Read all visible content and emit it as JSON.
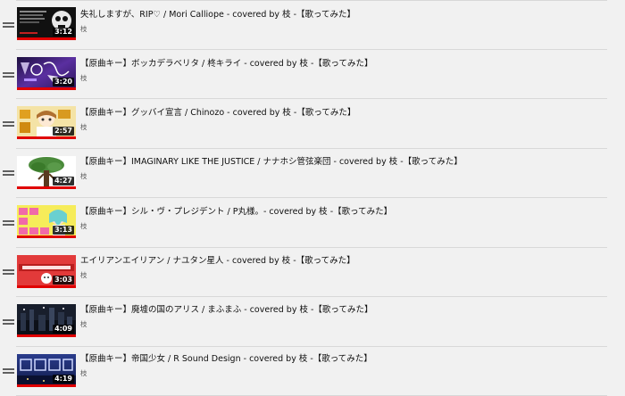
{
  "playlist": {
    "items": [
      {
        "title": "失礼しますが、RIP♡ / Mori Calliope - covered by 枝 -【歌ってみた】",
        "channel": "枝",
        "duration": "3:12",
        "thumb_icon": "thumbnail-dark-skull-image",
        "thumb_color": "#111111"
      },
      {
        "title": "【原曲キー】ボッカデラベリタ / 柊キライ - covered by 枝 -【歌ってみた】",
        "channel": "枝",
        "duration": "3:20",
        "thumb_icon": "thumbnail-purple-text-image",
        "thumb_color": "#3a1a6b"
      },
      {
        "title": "【原曲キー】グッバイ宣言 / Chinozo - covered by 枝 -【歌ってみた】",
        "channel": "枝",
        "duration": "2:57",
        "thumb_icon": "thumbnail-anime-girl-yellow-image",
        "thumb_color": "#f2e2a0"
      },
      {
        "title": "【原曲キー】IMAGINARY LIKE THE JUSTICE / ナナホシ管弦楽団 - covered by 枝 -【歌ってみた】",
        "channel": "枝",
        "duration": "4:27",
        "thumb_icon": "thumbnail-tree-image",
        "thumb_color": "#ffffff"
      },
      {
        "title": "【原曲キー】シル・ヴ・プレジデント / P丸様。- covered by 枝 -【歌ってみた】",
        "channel": "枝",
        "duration": "3:13",
        "thumb_icon": "thumbnail-pink-yellow-image",
        "thumb_color": "#f4e860"
      },
      {
        "title": "エイリアンエイリアン / ナユタン星人 - covered by 枝 -【歌ってみた】",
        "channel": "枝",
        "duration": "3:03",
        "thumb_icon": "thumbnail-red-alien-image",
        "thumb_color": "#e03a3a"
      },
      {
        "title": "【原曲キー】廃墟の国のアリス / まふまふ - covered by 枝 -【歌ってみた】",
        "channel": "枝",
        "duration": "4:09",
        "thumb_icon": "thumbnail-dark-city-image",
        "thumb_color": "#1a2030"
      },
      {
        "title": "【原曲キー】帝国少女 / R Sound Design - covered by 枝 -【歌ってみた】",
        "channel": "枝",
        "duration": "4:19",
        "thumb_icon": "thumbnail-blue-night-image",
        "thumb_color": "#1a2a6a"
      }
    ],
    "progress_color": "#e00000"
  }
}
